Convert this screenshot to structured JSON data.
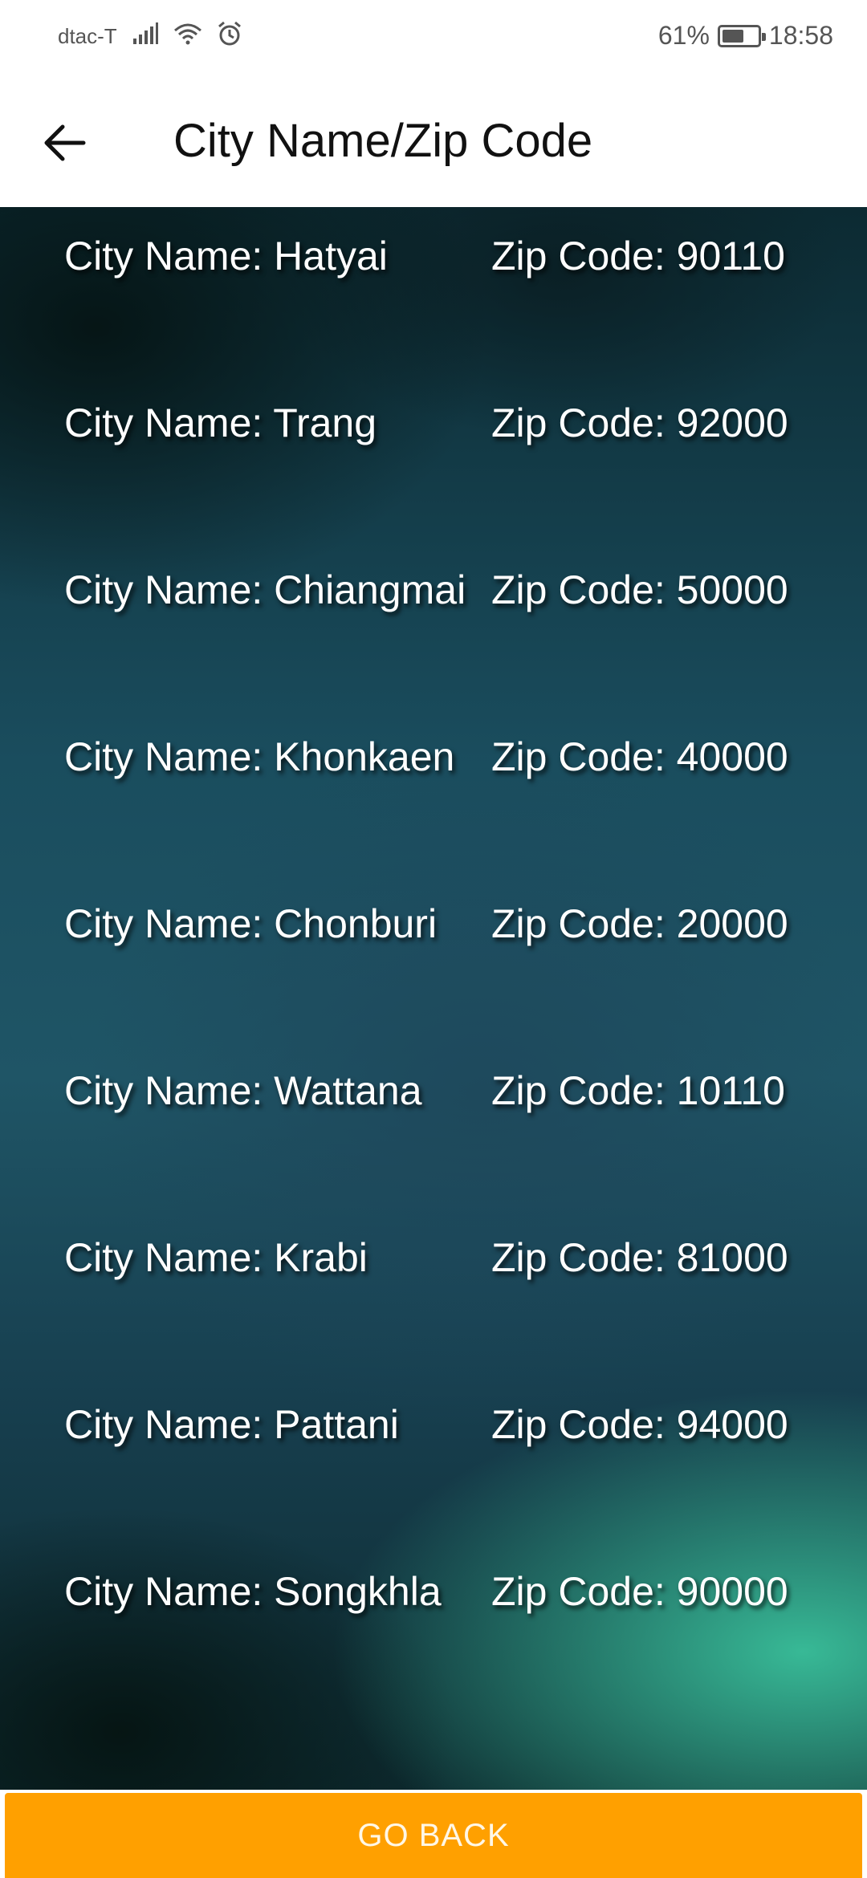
{
  "status_bar": {
    "carrier": "dtac-T",
    "battery_text": "61%",
    "battery_level": 0.61,
    "time": "18:58",
    "icons": [
      "signal-icon",
      "wifi-icon",
      "alarm-icon",
      "battery-icon"
    ]
  },
  "app_bar": {
    "back_icon": "arrow-left-icon",
    "title": "City Name/Zip Code"
  },
  "cities": [
    {
      "name_label": "City Name: Hatyai",
      "zip_label": "Zip Code: 90110"
    },
    {
      "name_label": "City Name: Trang",
      "zip_label": "Zip Code: 92000"
    },
    {
      "name_label": "City Name: Chiangmai",
      "zip_label": "Zip Code: 50000"
    },
    {
      "name_label": "City Name: Khonkaen",
      "zip_label": "Zip Code: 40000"
    },
    {
      "name_label": "City Name: Chonburi",
      "zip_label": "Zip Code: 20000"
    },
    {
      "name_label": "City Name: Wattana",
      "zip_label": "Zip Code: 10110"
    },
    {
      "name_label": "City Name: Krabi",
      "zip_label": "Zip Code: 81000"
    },
    {
      "name_label": "City Name: Pattani",
      "zip_label": "Zip Code: 94000"
    },
    {
      "name_label": "City Name: Songkhla",
      "zip_label": "Zip Code: 90000"
    }
  ],
  "footer": {
    "go_back_label": "GO BACK"
  },
  "colors": {
    "accent": "#ffa000",
    "row_text": "#ffffff"
  }
}
